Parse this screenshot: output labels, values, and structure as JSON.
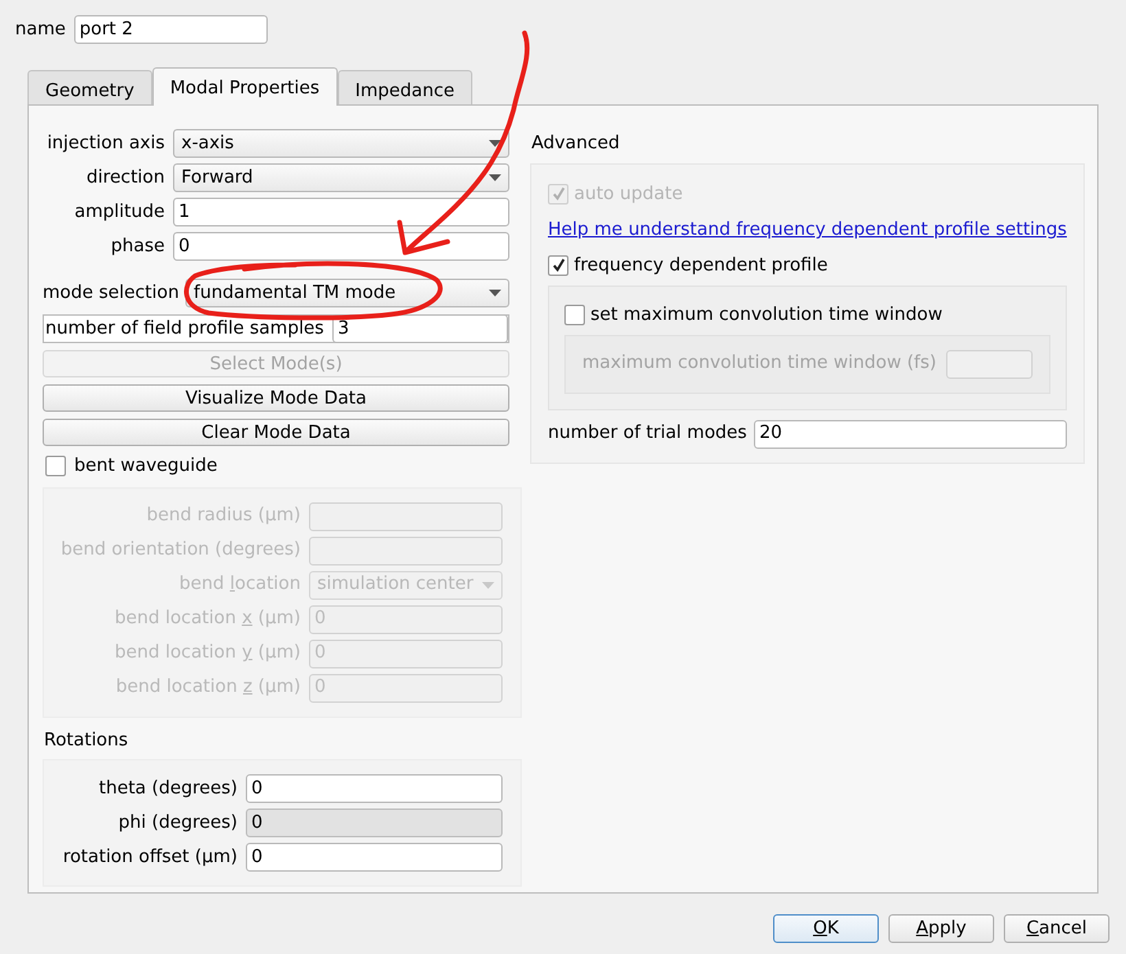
{
  "name_field": {
    "label": "name",
    "value": "port 2"
  },
  "tabs": [
    {
      "label": "Geometry",
      "selected": false
    },
    {
      "label": "Modal Properties",
      "selected": true
    },
    {
      "label": "Impedance",
      "selected": false
    }
  ],
  "modal": {
    "fields": [
      {
        "kind": "select",
        "label": "injection axis",
        "value": "x-axis"
      },
      {
        "kind": "select",
        "label": "direction",
        "value": "Forward"
      },
      {
        "kind": "input",
        "label": "amplitude",
        "value": "1"
      },
      {
        "kind": "input",
        "label": "phase",
        "value": "0"
      }
    ],
    "mode_selection": {
      "label": "mode selection",
      "value": "fundamental TM mode"
    },
    "samples": {
      "label": "number of field profile samples",
      "value": "3"
    },
    "buttons": [
      {
        "label": "Select Mode(s)",
        "disabled": true
      },
      {
        "label": "Visualize Mode Data",
        "disabled": false
      },
      {
        "label": "Clear Mode Data",
        "disabled": false
      }
    ],
    "bent_waveguide": {
      "label": "bent waveguide",
      "checked": false,
      "fields": [
        {
          "kind": "input",
          "label_parts": [
            "bend radius (µm)"
          ]
        },
        {
          "kind": "input",
          "label_parts": [
            "bend orientation (degrees)"
          ]
        },
        {
          "kind": "select",
          "label_parts": [
            "bend ",
            "l",
            "ocation"
          ],
          "value": "simulation center"
        },
        {
          "kind": "input",
          "label_parts": [
            "bend location ",
            "x",
            " (µm)"
          ],
          "value": "0"
        },
        {
          "kind": "input",
          "label_parts": [
            "bend location ",
            "y",
            " (µm)"
          ],
          "value": "0"
        },
        {
          "kind": "input",
          "label_parts": [
            "bend location ",
            "z",
            " (µm)"
          ],
          "value": "0"
        }
      ]
    },
    "rotations": {
      "title": "Rotations",
      "fields": [
        {
          "label": "theta (degrees)",
          "value": "0",
          "disabled": false
        },
        {
          "label": "phi (degrees)",
          "value": "0",
          "disabled": true
        },
        {
          "label": "rotation offset (µm)",
          "value": "0",
          "disabled": false
        }
      ]
    }
  },
  "advanced": {
    "title": "Advanced",
    "auto_update": {
      "label": "auto update",
      "checked": true,
      "disabled": true
    },
    "help_link": "Help me understand frequency dependent profile settings",
    "frequency_dependent": {
      "label": "frequency dependent profile",
      "checked": true,
      "disabled": false
    },
    "max_window": {
      "label": "set maximum convolution time window",
      "checked": false,
      "disabled": false
    },
    "max_window_field": {
      "label": "maximum convolution time window (fs)"
    },
    "trial_modes": {
      "label": "number of trial modes",
      "value": "20"
    }
  },
  "buttons": [
    {
      "label_parts": [
        "O",
        "K"
      ],
      "default": true
    },
    {
      "label_parts": [
        "A",
        "pply"
      ],
      "default": false
    },
    {
      "label_parts": [
        "C",
        "ancel"
      ],
      "default": false
    }
  ]
}
